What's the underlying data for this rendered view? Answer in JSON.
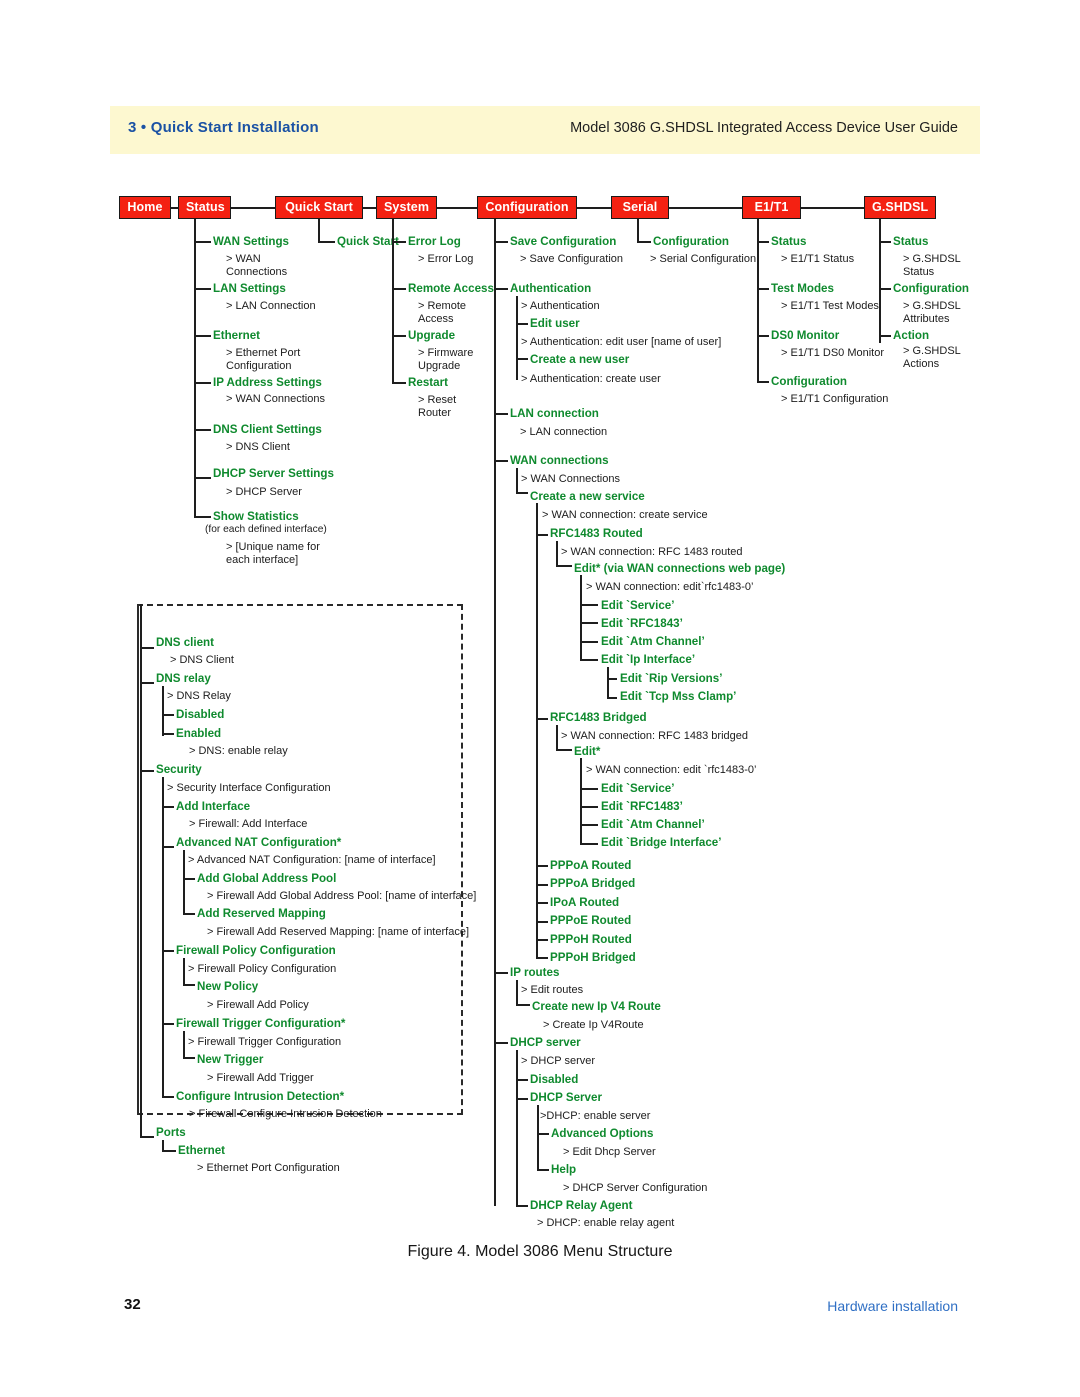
{
  "header": {
    "chapter": "3 • Quick Start Installation",
    "guide": "Model 3086 G.SHDSL Integrated Access Device User Guide"
  },
  "figure": {
    "caption": "Figure 4. Model 3086 Menu Structure"
  },
  "footer": {
    "page_number": "32",
    "right_label": "Hardware installation"
  },
  "colors": {
    "tab_background": "#f42112",
    "tab_text": "#ffffff",
    "node_green": "#0f8a2e",
    "header_band": "#fdf8d0",
    "chapter_blue": "#1b52a4",
    "footer_blue": "#2f6fc4",
    "line": "#1e1e1e"
  },
  "tabs": [
    {
      "label": "Home"
    },
    {
      "label": "Status"
    },
    {
      "label": "Quick Start"
    },
    {
      "label": "System"
    },
    {
      "label": "Configuration"
    },
    {
      "label": "Serial"
    },
    {
      "label": "E1/T1"
    },
    {
      "label": "G.SHDSL"
    }
  ],
  "status_branch": {
    "wan_settings": "WAN Settings",
    "wan_settings_page": "> WAN Connections",
    "lan_settings": "LAN Settings",
    "lan_settings_page": "> LAN Connection",
    "ethernet": "Ethernet",
    "ethernet_page": "> Ethernet Port Configuration",
    "ip_address_settings": "IP Address Settings",
    "ip_address_settings_page": "> WAN Connections",
    "dns_client_settings": "DNS Client Settings",
    "dns_client_settings_page": "> DNS Client",
    "dhcp_server_settings": "DHCP Server Settings",
    "dhcp_server_settings_page": "> DHCP Server",
    "show_statistics": "Show Statistics",
    "show_statistics_note": "(for each defined interface)",
    "show_statistics_page": "> [Unique name for each interface]"
  },
  "quickstart_branch": {
    "quick_start": "Quick Start"
  },
  "system_branch": {
    "error_log": "Error Log",
    "error_log_page": "> Error Log",
    "remote_access": "Remote Access",
    "remote_access_page": "> Remote Access",
    "upgrade": "Upgrade",
    "upgrade_page": "> Firmware Upgrade",
    "restart": "Restart",
    "restart_page": "> Reset Router"
  },
  "configuration_branch": {
    "save_configuration": "Save Configuration",
    "save_configuration_page": "> Save Configuration",
    "authentication": "Authentication",
    "authentication_page": "> Authentication",
    "edit_user": "Edit user",
    "edit_user_page": "> Authentication: edit user [name of user]",
    "create_new_user": "Create a new user",
    "create_new_user_page": "> Authentication: create user",
    "lan_connection": "LAN connection",
    "lan_connection_page": "> LAN connection",
    "wan_connections": "WAN connections",
    "wan_connections_page": "> WAN Connections",
    "create_new_service": "Create a new service",
    "create_new_service_page": "> WAN connection:  create service",
    "rfc1483_routed": "RFC1483 Routed",
    "rfc1483_routed_page": "> WAN connection:  RFC 1483 routed",
    "rfc1483_routed_edit": "Edit* (via WAN connections web page)",
    "rfc1483_routed_edit_page": "> WAN connection:  edit`rfc1483-0’",
    "edit_service_r": "Edit `Service’",
    "edit_rfc1843_r": "Edit `RFC1843’",
    "edit_atm_channel_r": "Edit `Atm Channel’",
    "edit_ip_interface_r": "Edit `Ip Interface’",
    "edit_rip_versions": "Edit `Rip Versions’",
    "edit_tcp_mss_clamp": "Edit `Tcp Mss Clamp’",
    "rfc1483_bridged": "RFC1483 Bridged",
    "rfc1483_bridged_page": "> WAN connection:  RFC 1483 bridged",
    "rfc1483_bridged_edit": "Edit*",
    "rfc1483_bridged_edit_page": "> WAN connection:  edit `rfc1483-0’",
    "edit_service_b": "Edit `Service’",
    "edit_rfc1483_b": "Edit `RFC1483’",
    "edit_atm_channel_b": "Edit `Atm Channel’",
    "edit_bridge_interface_b": "Edit `Bridge Interface’",
    "pppoa_routed": "PPPoA Routed",
    "pppoa_bridged": "PPPoA Bridged",
    "ipoa_routed": "IPoA Routed",
    "pppoe_routed": "PPPoE Routed",
    "pppoh_routed": "PPPoH Routed",
    "pppoh_bridged": "PPPoH Bridged",
    "ip_routes": "IP routes",
    "ip_routes_page": "> Edit routes",
    "create_new_ip_v4_route": "Create new Ip V4 Route",
    "create_new_ip_v4_route_page": "> Create Ip V4Route",
    "dhcp_server": "DHCP server",
    "dhcp_server_page": "> DHCP server",
    "dhcp_disabled": "Disabled",
    "dhcp_server_node": "DHCP Server",
    "dhcp_server_node_page": ">DHCP:  enable server",
    "advanced_options": "Advanced Options",
    "advanced_options_page": "> Edit Dhcp Server",
    "help": "Help",
    "help_page": "> DHCP Server Configuration",
    "dhcp_relay_agent": "DHCP Relay Agent",
    "dhcp_relay_agent_page": "> DHCP:  enable relay agent"
  },
  "serial_branch": {
    "configuration": "Configuration",
    "configuration_page": "> Serial Configuration"
  },
  "e1t1_branch": {
    "status": "Status",
    "status_page": "> E1/T1 Status",
    "test_modes": "Test Modes",
    "test_modes_page": "> E1/T1 Test Modes",
    "ds0_monitor": "DS0 Monitor",
    "ds0_monitor_page": "> E1/T1 DS0 Monitor",
    "configuration": "Configuration",
    "configuration_page": "> E1/T1 Configuration"
  },
  "gshdsl_branch": {
    "status": "Status",
    "status_page": "> G.SHDSL Status",
    "configuration": "Configuration",
    "configuration_page": "> G.SHDSL Attributes",
    "action": "Action",
    "action_page": "> G.SHDSL Actions"
  },
  "dashed_branch": {
    "dns_client": "DNS client",
    "dns_client_page": "> DNS Client",
    "dns_relay": "DNS relay",
    "dns_relay_page": "> DNS Relay",
    "dns_relay_disabled": "Disabled",
    "dns_relay_enabled": "Enabled",
    "dns_relay_enabled_page": "> DNS: enable relay",
    "security": "Security",
    "security_page": "> Security Interface Configuration",
    "add_interface": "Add Interface",
    "add_interface_page": "> Firewall:  Add Interface",
    "advanced_nat": "Advanced NAT Configuration*",
    "advanced_nat_page": "> Advanced NAT Configuration: [name of interface]",
    "add_global_address_pool": "Add Global Address Pool",
    "add_global_address_pool_page": "> Firewall Add Global Address Pool: [name of interface]",
    "add_reserved_mapping": "Add Reserved Mapping",
    "add_reserved_mapping_page": "> Firewall Add Reserved Mapping: [name of interface]",
    "firewall_policy_configuration": "Firewall Policy Configuration",
    "firewall_policy_configuration_page": "> Firewall Policy Configuration",
    "new_policy": "New Policy",
    "new_policy_page": "> Firewall Add Policy",
    "firewall_trigger_configuration": "Firewall Trigger Configuration*",
    "firewall_trigger_configuration_page": "> Firewall Trigger Configuration",
    "new_trigger": "New Trigger",
    "new_trigger_page": "> Firewall Add Trigger",
    "configure_intrusion_detection": "Configure Intrusion Detection*",
    "configure_intrusion_detection_page": "> Firewall Configure Intrusion Detection",
    "ports": "Ports",
    "ports_ethernet": "Ethernet",
    "ports_ethernet_page": "> Ethernet Port Configuration"
  }
}
